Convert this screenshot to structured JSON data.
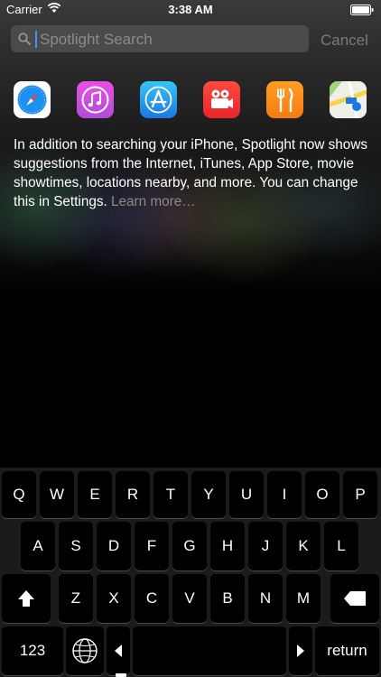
{
  "status_bar": {
    "carrier": "Carrier",
    "time": "3:38 AM"
  },
  "search": {
    "placeholder": "Spotlight Search",
    "value": "",
    "cancel_label": "Cancel"
  },
  "suggested_apps": [
    {
      "name": "safari-icon"
    },
    {
      "name": "music-icon"
    },
    {
      "name": "app-store-icon"
    },
    {
      "name": "videos-icon"
    },
    {
      "name": "food-icon"
    },
    {
      "name": "maps-icon"
    }
  ],
  "info": {
    "text": "In addition to searching your iPhone, Spotlight now shows suggestions from the Internet, iTunes, App Store, movie showtimes, locations nearby, and more. You can change this in Settings.",
    "learn_more": "Learn more…"
  },
  "keyboard": {
    "row1": [
      "Q",
      "W",
      "E",
      "R",
      "T",
      "Y",
      "U",
      "I",
      "O",
      "P"
    ],
    "row2": [
      "A",
      "S",
      "D",
      "F",
      "G",
      "H",
      "J",
      "K",
      "L"
    ],
    "row3": [
      "Z",
      "X",
      "C",
      "V",
      "B",
      "N",
      "M"
    ],
    "numbers_label": "123",
    "return_label": "return"
  },
  "colors": {
    "caret": "#4a8cf5",
    "background": "#000000",
    "key": "#000000"
  }
}
